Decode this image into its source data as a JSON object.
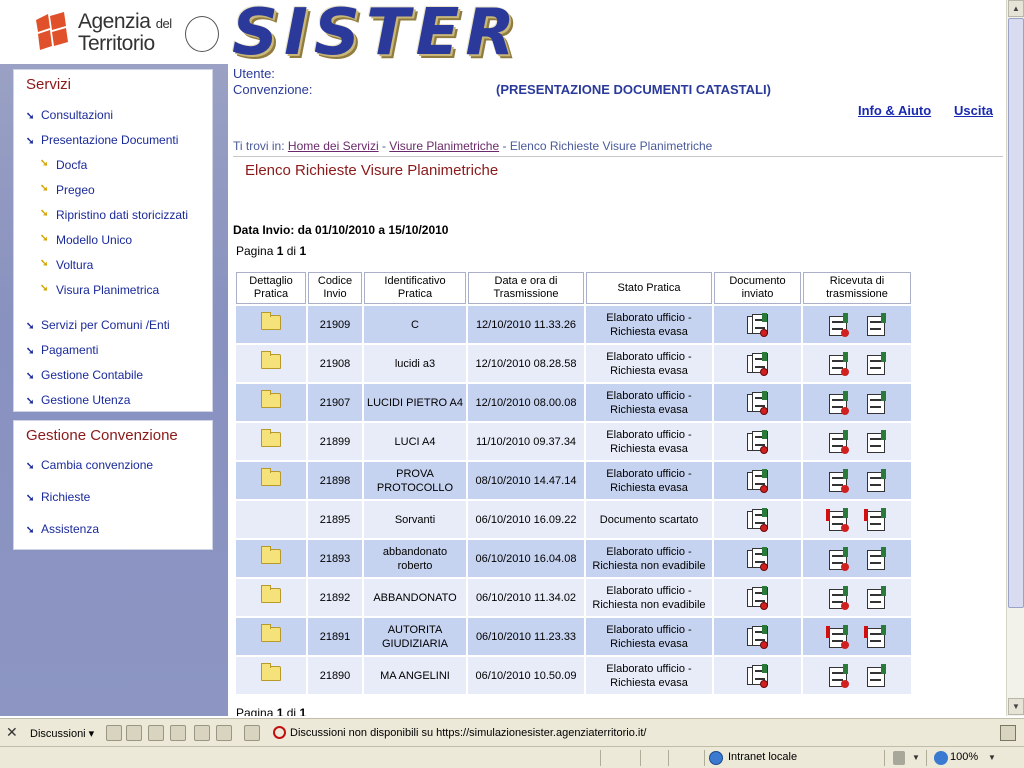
{
  "header": {
    "agenzia_line1": "Agenzia",
    "agenzia_del": "del",
    "agenzia_line2": "Territorio",
    "app_logo": "SISTER"
  },
  "sidebar": {
    "servizi_title": "Servizi",
    "servizi_items": [
      {
        "label": "Consultazioni"
      },
      {
        "label": "Presentazione Documenti"
      }
    ],
    "presentazione_sub": [
      {
        "label": "Docfa"
      },
      {
        "label": "Pregeo"
      },
      {
        "label": "Ripristino dati storicizzati"
      },
      {
        "label": "Modello Unico"
      },
      {
        "label": "Voltura"
      },
      {
        "label": "Visura Planimetrica"
      }
    ],
    "other_items": [
      {
        "label": "Servizi per Comuni /Enti"
      },
      {
        "label": "Pagamenti"
      },
      {
        "label": "Gestione Contabile"
      },
      {
        "label": "Gestione Utenza"
      }
    ],
    "convenzione_title": "Gestione Convenzione",
    "convenzione_items": [
      {
        "label": "Cambia convenzione"
      },
      {
        "label": "Richieste"
      },
      {
        "label": "Assistenza"
      }
    ]
  },
  "main": {
    "user_label": "Utente:",
    "conv_label": "Convenzione:",
    "section_name": "(PRESENTAZIONE DOCUMENTI CATASTALI)",
    "info_link": "Info & Aiuto",
    "exit_link": "Uscita",
    "breadcrumb_prefix": "Ti trovi in:",
    "breadcrumb": [
      {
        "label": "Home dei Servizi"
      },
      {
        "label": "Visure Planimetriche"
      },
      {
        "label": "Elenco Richieste Visure Planimetriche"
      }
    ],
    "breadcrumb_sep": "-",
    "page_title": "Elenco Richieste Visure Planimetriche",
    "date_info": "Data Invio: da 01/10/2010 a 15/10/2010",
    "pagina_prefix": "Pagina",
    "pagina_current": "1",
    "pagina_of": "di",
    "pagina_total": "1"
  },
  "table": {
    "headers": [
      "Dettaglio Pratica",
      "Codice Invio",
      "Identificativo Pratica",
      "Data e ora di Trasmissione",
      "Stato Pratica",
      "Documento inviato",
      "Ricevuta di trasmissione"
    ],
    "rows": [
      {
        "folder": true,
        "codice": "21909",
        "identificativo": "C",
        "data": "12/10/2010 11.33.26",
        "stato": "Elaborato ufficio - Richiesta evasa",
        "alert": false
      },
      {
        "folder": true,
        "codice": "21908",
        "identificativo": "lucidi a3",
        "data": "12/10/2010 08.28.58",
        "stato": "Elaborato ufficio - Richiesta evasa",
        "alert": false
      },
      {
        "folder": true,
        "codice": "21907",
        "identificativo": "LUCIDI PIETRO A4",
        "data": "12/10/2010 08.00.08",
        "stato": "Elaborato ufficio - Richiesta evasa",
        "alert": false
      },
      {
        "folder": true,
        "codice": "21899",
        "identificativo": "LUCI A4",
        "data": "11/10/2010 09.37.34",
        "stato": "Elaborato ufficio - Richiesta evasa",
        "alert": false
      },
      {
        "folder": true,
        "codice": "21898",
        "identificativo": "PROVA PROTOCOLLO",
        "data": "08/10/2010 14.47.14",
        "stato": "Elaborato ufficio - Richiesta evasa",
        "alert": false
      },
      {
        "folder": false,
        "codice": "21895",
        "identificativo": "Sorvanti",
        "data": "06/10/2010 16.09.22",
        "stato": "Documento scartato",
        "alert": true
      },
      {
        "folder": true,
        "codice": "21893",
        "identificativo": "abbandonato roberto",
        "data": "06/10/2010 16.04.08",
        "stato": "Elaborato ufficio - Richiesta non evadibile",
        "alert": false
      },
      {
        "folder": true,
        "codice": "21892",
        "identificativo": "ABBANDONATO",
        "data": "06/10/2010 11.34.02",
        "stato": "Elaborato ufficio - Richiesta non evadibile",
        "alert": false
      },
      {
        "folder": true,
        "codice": "21891",
        "identificativo": "AUTORITA GIUDIZIARIA",
        "data": "06/10/2010 11.23.33",
        "stato": "Elaborato ufficio - Richiesta evasa",
        "alert": true
      },
      {
        "folder": true,
        "codice": "21890",
        "identificativo": "MA ANGELINI",
        "data": "06/10/2010 10.50.09",
        "stato": "Elaborato ufficio - Richiesta evasa",
        "alert": false
      }
    ]
  },
  "discuss_bar": {
    "menu_label": "Discussioni ▾",
    "message": "Discussioni non disponibili su https://simulazionesister.agenziaterritorio.it/"
  },
  "status_bar": {
    "zone": "Intranet locale",
    "zoom": "100%"
  },
  "colors": {
    "sidebar_bg": "#8c96c2",
    "title_red": "#8b1a1a",
    "link_blue": "#1a2a9a",
    "row_odd": "#c6d3f0",
    "row_even": "#e8ecf8"
  }
}
